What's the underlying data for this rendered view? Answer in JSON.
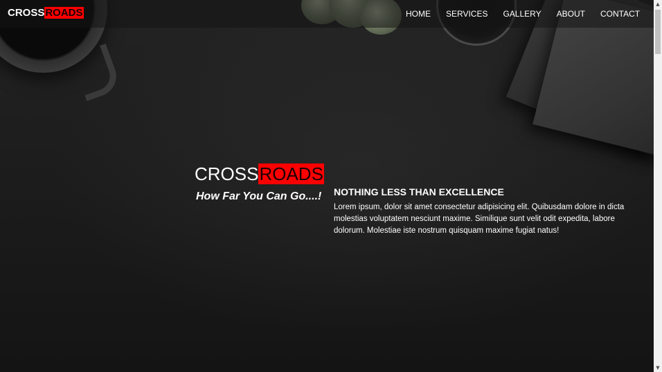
{
  "brand": {
    "prefix": "CROSS",
    "highlight": "ROADS"
  },
  "nav": {
    "items": [
      "HOME",
      "SERVICES",
      "GALLERY",
      "ABOUT",
      "CONTACT"
    ]
  },
  "hero": {
    "logo_prefix": "CROSS",
    "logo_highlight": "ROADS",
    "tagline": "How Far You Can Go....!",
    "section_title": "NOTHING LESS THAN EXCELLENCE",
    "section_body": "Lorem ipsum, dolor sit amet consectetur adipisicing elit. Quibusdam dolore in dicta molestias voluptatem nesciunt maxime. Similique sunt velit odit expedita, labore dolorum. Molestiae iste nostrum quisquam maxime fugiat natus!"
  },
  "colors": {
    "accent": "#ff0000",
    "text": "#ffffff",
    "background": "#1b1b1b"
  },
  "icons": {
    "scroll_up": "triangle-up-icon",
    "scroll_down": "triangle-down-icon"
  }
}
